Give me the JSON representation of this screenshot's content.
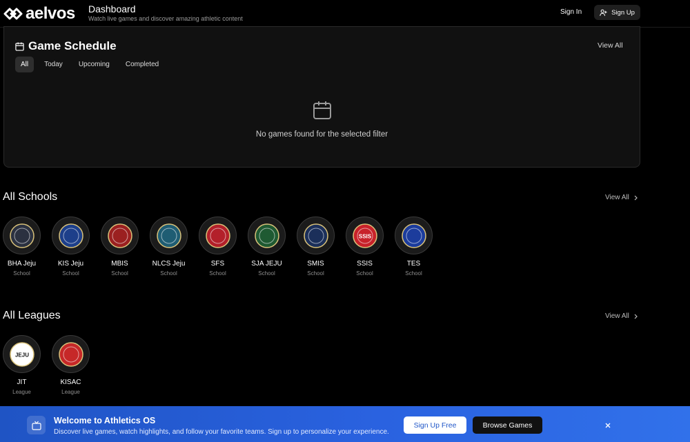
{
  "header": {
    "logo_text": "aelvos",
    "title": "Dashboard",
    "subtitle": "Watch live games and discover amazing athletic content",
    "sign_in": "Sign In",
    "sign_up": "Sign Up"
  },
  "schedule": {
    "title": "Game Schedule",
    "view_all": "View All",
    "filters": [
      {
        "label": "All",
        "active": true
      },
      {
        "label": "Today",
        "active": false
      },
      {
        "label": "Upcoming",
        "active": false
      },
      {
        "label": "Completed",
        "active": false
      }
    ],
    "empty_text": "No games found for the selected filter"
  },
  "schools": {
    "title": "All Schools",
    "view_all": "View All",
    "items": [
      {
        "name": "BHA Jeju",
        "type": "School",
        "color": "#2b3140",
        "logo_text": ""
      },
      {
        "name": "KIS Jeju",
        "type": "School",
        "color": "#1d3f8a",
        "logo_text": ""
      },
      {
        "name": "MBIS",
        "type": "School",
        "color": "#9b2020",
        "logo_text": ""
      },
      {
        "name": "NLCS Jeju",
        "type": "School",
        "color": "#1f5d73",
        "logo_text": ""
      },
      {
        "name": "SFS",
        "type": "School",
        "color": "#b3202a",
        "logo_text": ""
      },
      {
        "name": "SJA JEJU",
        "type": "School",
        "color": "#1f5a32",
        "logo_text": ""
      },
      {
        "name": "SMIS",
        "type": "School",
        "color": "#1b2f5a",
        "logo_text": ""
      },
      {
        "name": "SSIS",
        "type": "School",
        "color": "#c8222a",
        "logo_text": "SSIS"
      },
      {
        "name": "TES",
        "type": "School",
        "color": "#1c3c9c",
        "logo_text": ""
      }
    ]
  },
  "leagues": {
    "title": "All Leagues",
    "view_all": "View All",
    "items": [
      {
        "name": "JIT",
        "type": "League",
        "color": "#ffffff",
        "logo_text": "JEJU"
      },
      {
        "name": "KISAC",
        "type": "League",
        "color": "#c62828",
        "logo_text": ""
      }
    ]
  },
  "banner": {
    "title": "Welcome to Athletics OS",
    "subtitle": "Discover live games, watch highlights, and follow your favorite teams. Sign up to personalize your experience.",
    "primary": "Sign Up Free",
    "secondary": "Browse Games"
  }
}
